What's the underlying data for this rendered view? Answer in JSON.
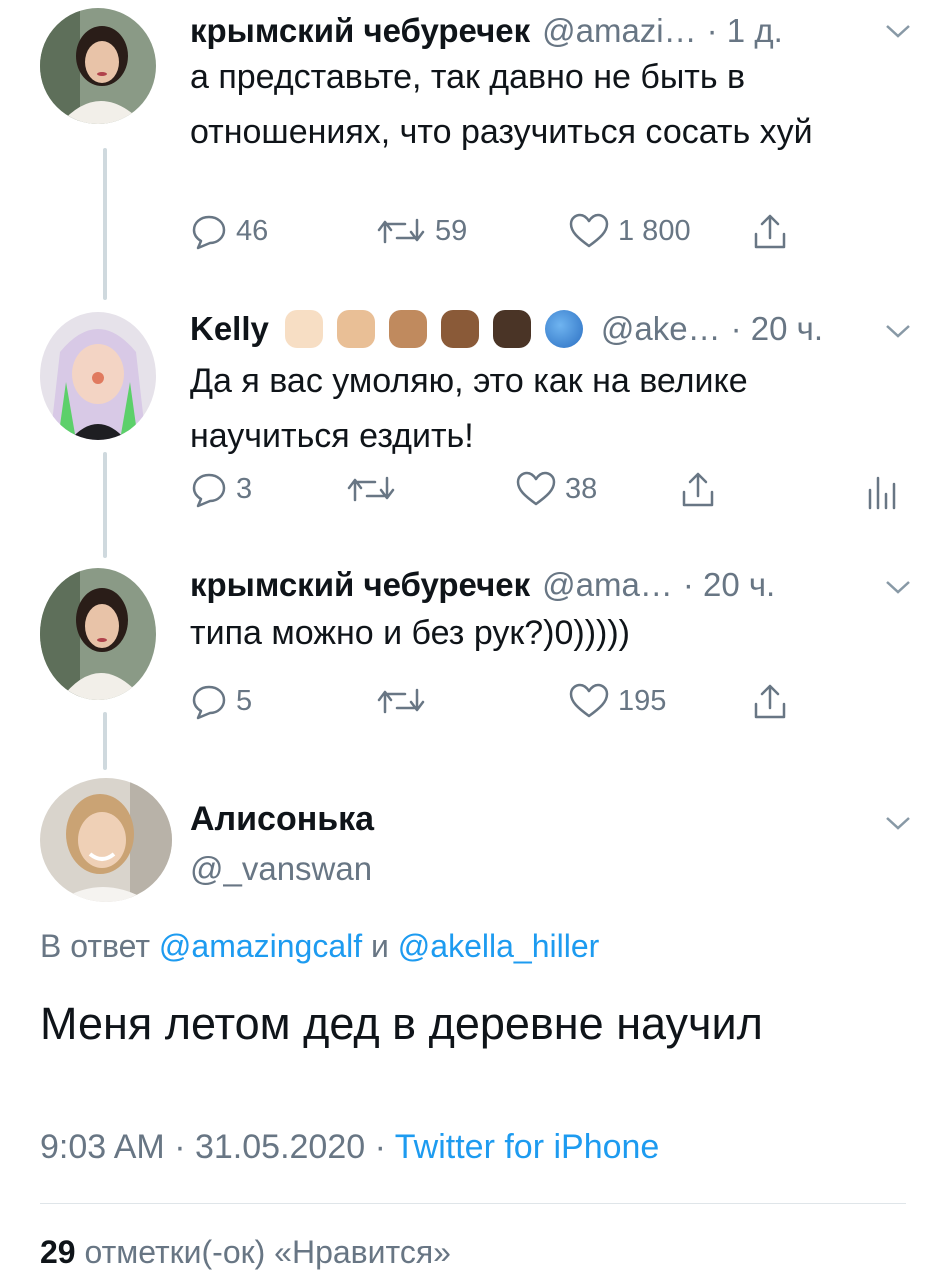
{
  "thread": [
    {
      "name": "крымский чебуречек",
      "handle": "@amazi…",
      "time": "· 1 д.",
      "text": "а представьте, так давно не быть в отношениях, что разучиться сосать хуй",
      "replies": "46",
      "retweets": "59",
      "likes": "1 800"
    },
    {
      "name": "Kelly",
      "emoji": [
        "raised-fist-light",
        "raised-fist-medium-light",
        "raised-fist-medium",
        "raised-fist-medium-dark",
        "raised-fist-dark",
        "globe-europe-africa"
      ],
      "handle": "@ake…",
      "time": "· 20 ч.",
      "text": "Да я вас умоляю, это как на велике научиться ездить!",
      "replies": "3",
      "retweets": "",
      "likes": "38"
    },
    {
      "name": "крымский чебуречек",
      "handle": "@ama…",
      "time": "· 20 ч.",
      "text": "типа можно и без рук?)0)))))",
      "replies": "5",
      "retweets": "",
      "likes": "195"
    }
  ],
  "main": {
    "name": "Алисонька",
    "handle": "@_vanswan",
    "reply_prefix": "В ответ",
    "reply_to_1": "@amazingcalf",
    "reply_conj": "и",
    "reply_to_2": "@akella_hiller",
    "text": "Меня летом дед в деревне научил",
    "time": "9:03 AM",
    "date": "31.05.2020",
    "source": "Twitter for iPhone",
    "likes_count": "29",
    "likes_label": "отметки(-ок) «Нравится»"
  },
  "colors": {
    "accent": "#1d9bf0",
    "muted": "#687684",
    "thread_line": "#cfd9de"
  }
}
